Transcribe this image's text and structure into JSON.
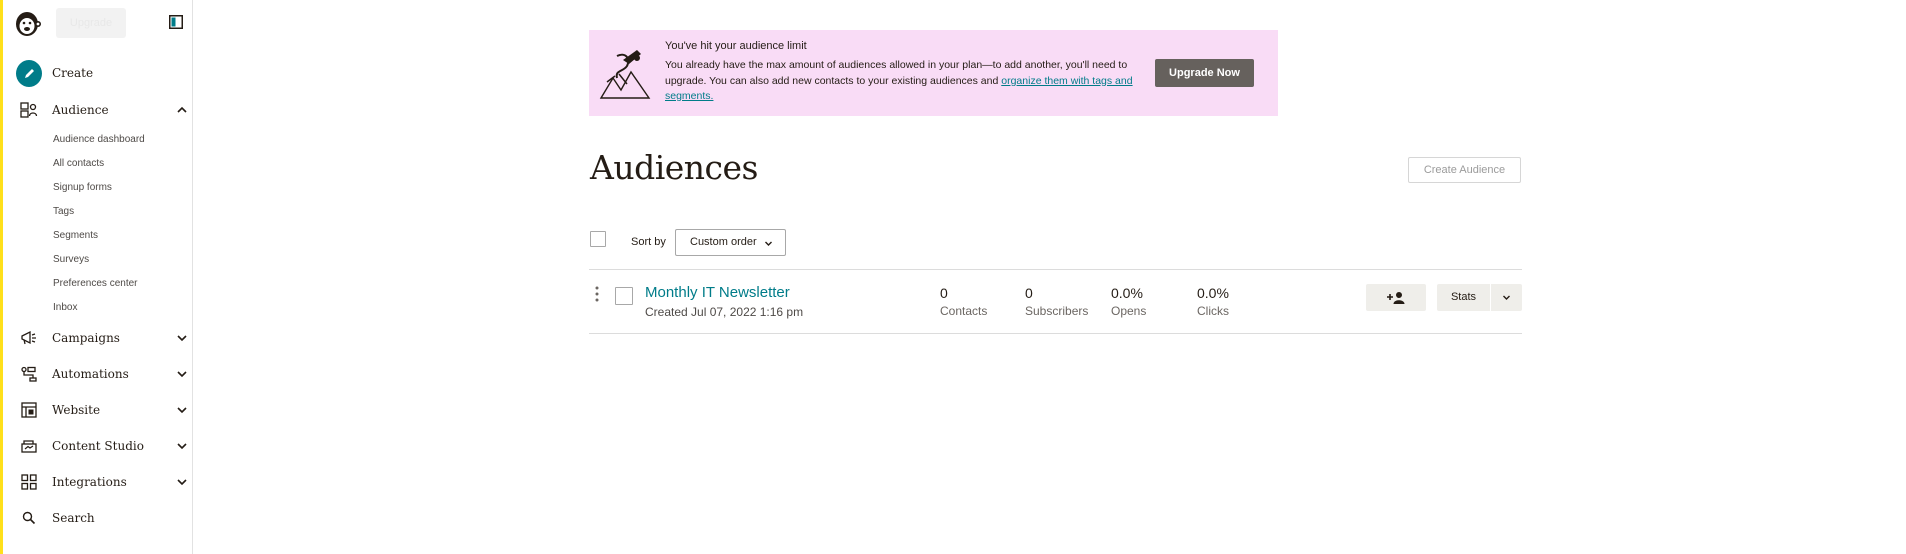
{
  "sidebar": {
    "upgrade_ghost": "Upgrade",
    "nav": [
      {
        "label": "Create",
        "icon": "pencil-icon"
      },
      {
        "label": "Audience",
        "icon": "audience-icon",
        "expanded": true
      },
      {
        "label": "Campaigns",
        "icon": "megaphone-icon"
      },
      {
        "label": "Automations",
        "icon": "automation-icon"
      },
      {
        "label": "Website",
        "icon": "website-icon"
      },
      {
        "label": "Content Studio",
        "icon": "content-studio-icon"
      },
      {
        "label": "Integrations",
        "icon": "grid-icon"
      },
      {
        "label": "Search",
        "icon": "search-icon"
      }
    ],
    "audience_subitems": [
      "Audience dashboard",
      "All contacts",
      "Signup forms",
      "Tags",
      "Segments",
      "Surveys",
      "Preferences center",
      "Inbox"
    ]
  },
  "banner": {
    "title": "You've hit your audience limit",
    "text": "You already have the max amount of audiences allowed in your plan—to add another, you'll need to upgrade. You can also add new contacts to your existing audiences and ",
    "link": "organize them with tags and segments.",
    "button": "Upgrade Now"
  },
  "page": {
    "title": "Audiences",
    "create_button": "Create Audience",
    "sort_label": "Sort by",
    "sort_value": "Custom order"
  },
  "audiences": [
    {
      "name": "Monthly IT Newsletter",
      "created": "Created Jul 07, 2022 1:16 pm",
      "stats": [
        {
          "value": "0",
          "label": "Contacts"
        },
        {
          "value": "0",
          "label": "Subscribers"
        },
        {
          "value": "0.0%",
          "label": "Opens"
        },
        {
          "value": "0.0%",
          "label": "Clicks"
        }
      ],
      "stats_button": "Stats"
    }
  ],
  "colors": {
    "accent": "#007c89",
    "banner_bg": "#f9dcf6",
    "sidebar_edge": "#ffe01b",
    "upgrade_button": "#66615d"
  }
}
